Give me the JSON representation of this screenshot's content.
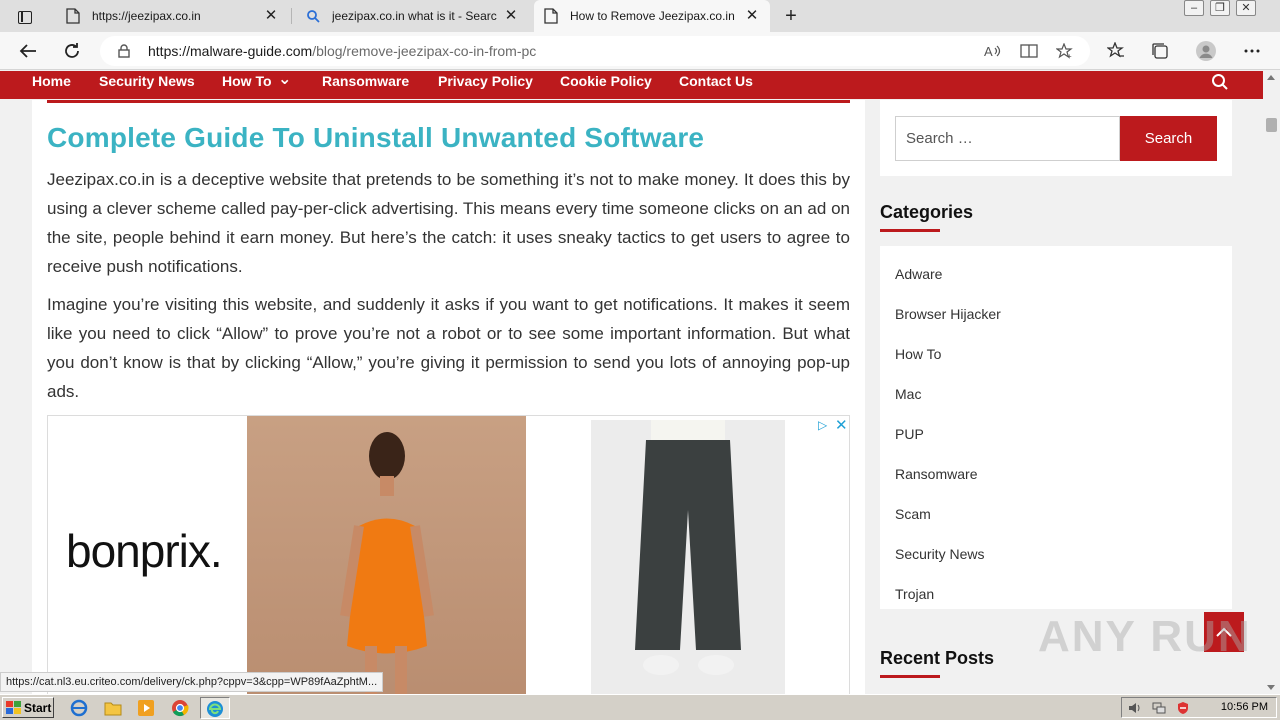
{
  "browser": {
    "tabs": [
      {
        "title": "https://jeezipax.co.in",
        "close": "✕"
      },
      {
        "title": "jeezipax.co.in what is it - Search",
        "close": "✕"
      },
      {
        "title": "How to Remove Jeezipax.co.in f",
        "close": "✕"
      }
    ],
    "new_tab": "+",
    "url_host": "https://malware-guide.com",
    "url_path": "/blog/remove-jeezipax-co-in-from-pc"
  },
  "site_nav": {
    "items": [
      "Home",
      "Security News",
      "How To",
      "Ransomware",
      "Privacy Policy",
      "Cookie Policy",
      "Contact Us"
    ],
    "how_to_caret": "⌄"
  },
  "article": {
    "heading": "Complete Guide To Uninstall Unwanted Software",
    "paragraph1": "Jeezipax.co.in is a deceptive website that pretends to be something it’s not to make money. It does this by using a clever scheme called pay-per-click advertising. This means every time someone clicks on an ad on the site, people behind it earn money. But here’s the catch: it uses sneaky tactics to get users to agree to receive push notifications.",
    "paragraph2": "Imagine you’re visiting this website, and suddenly it asks if you want to get notifications. It makes it seem like you need to click “Allow” to prove you’re not a robot or to see some important information. But what you don’t know is that by clicking “Allow,” you’re giving it permission to send you lots of annoying pop-up ads.",
    "ad_brand": "bonprix."
  },
  "sidebar": {
    "search_placeholder": "Search …",
    "search_button": "Search",
    "categories_title": "Categories",
    "categories": [
      "Adware",
      "Browser Hijacker",
      "How To",
      "Mac",
      "PUP",
      "Ransomware",
      "Scam",
      "Security News",
      "Trojan"
    ],
    "recent_posts_title": "Recent Posts"
  },
  "status_bar_url": "https://cat.nl3.eu.criteo.com/delivery/ck.php?cppv=3&cpp=WP89fAaZphtM...",
  "watermark": "ANY RUN",
  "taskbar": {
    "start_label": "Start",
    "clock": "10:56 PM"
  },
  "colors": {
    "brand_red": "#bc1a1d",
    "heading_teal": "#3bb3c3"
  }
}
